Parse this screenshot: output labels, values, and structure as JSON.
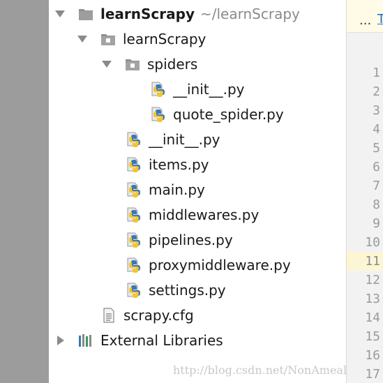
{
  "tree": {
    "root": {
      "label": "learnScrapy",
      "path": "~/learnScrapy",
      "icon": "folder-icon"
    },
    "package": {
      "label": "learnScrapy",
      "icon": "package-folder-icon"
    },
    "spiders": {
      "label": "spiders",
      "icon": "package-folder-icon"
    },
    "spider_files": [
      {
        "label": "__init__.py",
        "icon": "python-file-icon"
      },
      {
        "label": "quote_spider.py",
        "icon": "python-file-icon"
      }
    ],
    "package_files": [
      {
        "label": "__init__.py",
        "icon": "python-file-icon"
      },
      {
        "label": "items.py",
        "icon": "python-file-icon"
      },
      {
        "label": "main.py",
        "icon": "python-file-icon"
      },
      {
        "label": "middlewares.py",
        "icon": "python-file-icon"
      },
      {
        "label": "pipelines.py",
        "icon": "python-file-icon"
      },
      {
        "label": "proxymiddleware.py",
        "icon": "python-file-icon"
      },
      {
        "label": "settings.py",
        "icon": "python-file-icon"
      }
    ],
    "cfg_file": {
      "label": "scrapy.cfg",
      "icon": "text-file-icon"
    },
    "external": {
      "label": "External Libraries",
      "icon": "libraries-icon"
    }
  },
  "editor": {
    "tab_overflow": "...",
    "tab_link": "T",
    "line_numbers": [
      "1",
      "2",
      "3",
      "4",
      "5",
      "6",
      "7",
      "8",
      "9",
      "10",
      "11",
      "12",
      "13",
      "14",
      "15",
      "16",
      "17"
    ],
    "current_line": "11"
  },
  "watermark": "http://blog.csdn.net/NonAmeal",
  "colors": {
    "python_blue": "#3a78b5",
    "python_yellow": "#f2c531",
    "current_line_bg": "#fdf6d4",
    "tab_link": "#1a6cc9"
  }
}
